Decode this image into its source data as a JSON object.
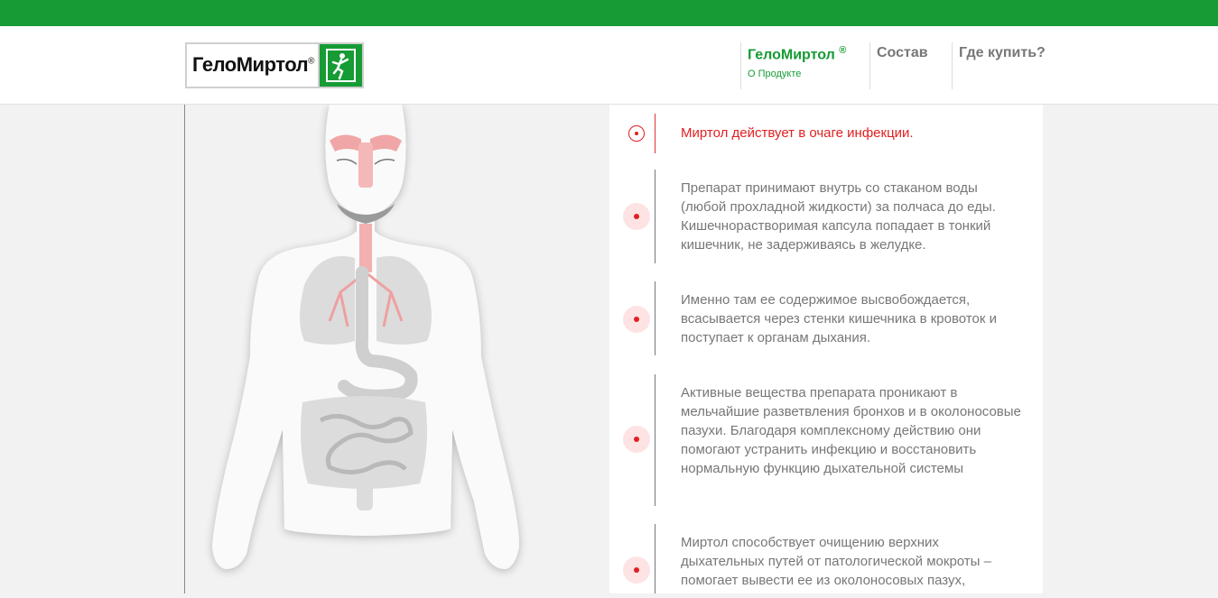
{
  "brand": {
    "logo_text": "ГелоМиртол",
    "logo_reg": "®",
    "logo_icon": "running-figure-icon",
    "bar_color": "#169b35"
  },
  "nav": [
    {
      "title": "ГелоМиртол",
      "sup": "®",
      "subtitle": "О Продукте",
      "active": true
    },
    {
      "title": "Состав"
    },
    {
      "title": "Где купить?"
    }
  ],
  "illustration": {
    "subject": "human-body-respiratory-digestive-icon"
  },
  "steps": [
    {
      "text": "Миртол действует в очаге инфекции.",
      "active": true
    },
    {
      "text": "Препарат принимают внутрь со стаканом воды (любой прохладной жидкости) за полчаса до еды. Кишечнорастворимая капсула попадает в тонкий кишечник, не задерживаясь в желудке."
    },
    {
      "text": "Именно там ее содержимое высвобождается, всасывается через стенки кишечника в кровоток и поступает к органам дыхания."
    },
    {
      "text": "Активные вещества препарата проникают в мельчайшие разветвления бронхов и в околоносовые пазухи. Благодаря комплексному действию они помогают устранить инфекцию и восстановить нормальную функцию дыхательной системы"
    },
    {
      "text": "Миртол способствует очищению верхних дыхательных путей от патологической мокроты – помогает вывести ее из околоносовых пазух,"
    }
  ],
  "colors": {
    "accent_green": "#169b35",
    "accent_red": "#e01f1f"
  }
}
